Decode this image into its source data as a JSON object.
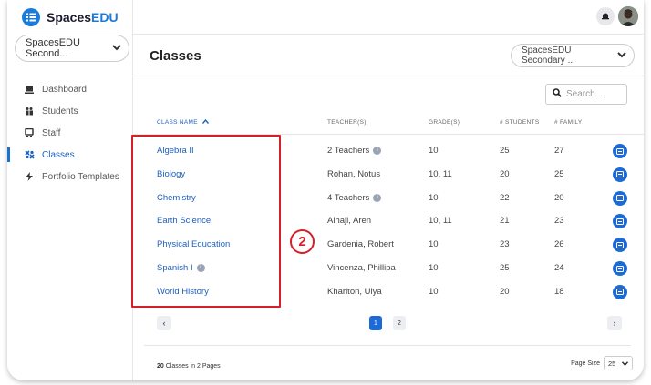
{
  "app": {
    "logo_text_prefix": "Spaces",
    "logo_text_suffix": "EDU",
    "school_select": "SpacesEDU Second...",
    "brand_color": "#1c7bd8"
  },
  "sidebar": {
    "items": [
      {
        "label": "Dashboard",
        "icon": "monitor-icon",
        "active": false
      },
      {
        "label": "Students",
        "icon": "students-icon",
        "active": false
      },
      {
        "label": "Staff",
        "icon": "staff-icon",
        "active": false
      },
      {
        "label": "Classes",
        "icon": "classes-icon",
        "active": true
      },
      {
        "label": "Portfolio Templates",
        "icon": "lightning-icon",
        "active": false
      }
    ]
  },
  "header": {
    "page_title": "Classes",
    "scope_select": "SpacesEDU Secondary ...",
    "search_placeholder": "Search..."
  },
  "table": {
    "columns": [
      "CLASS NAME",
      "TEACHER(S)",
      "GRADE(S)",
      "# STUDENTS",
      "# FAMILY"
    ],
    "sort_indicator": "^",
    "rows": [
      {
        "name": "Algebra II",
        "name_info": false,
        "teacher": "2 Teachers",
        "teacher_info": true,
        "grades": "10",
        "students": "25",
        "family": "27"
      },
      {
        "name": "Biology",
        "name_info": false,
        "teacher": "Rohan, Notus",
        "teacher_info": false,
        "grades": "10, 11",
        "students": "20",
        "family": "25"
      },
      {
        "name": "Chemistry",
        "name_info": false,
        "teacher": "4 Teachers",
        "teacher_info": true,
        "grades": "10",
        "students": "22",
        "family": "20"
      },
      {
        "name": "Earth Science",
        "name_info": false,
        "teacher": "Alhaji, Aren",
        "teacher_info": false,
        "grades": "10, 11",
        "students": "21",
        "family": "23"
      },
      {
        "name": "Physical Education",
        "name_info": false,
        "teacher": "Gardenia, Robert",
        "teacher_info": false,
        "grades": "10",
        "students": "23",
        "family": "26"
      },
      {
        "name": "Spanish I",
        "name_info": true,
        "teacher": "Vincenza, Phillipa",
        "teacher_info": false,
        "grades": "10",
        "students": "25",
        "family": "24"
      },
      {
        "name": "World History",
        "name_info": false,
        "teacher": "Khariton, Ulya",
        "teacher_info": false,
        "grades": "10",
        "students": "20",
        "family": "18"
      }
    ]
  },
  "annotation": {
    "callout_number": "2",
    "highlight_color": "#d42028"
  },
  "pagination": {
    "prev": "‹",
    "next": "›",
    "pages": [
      "1",
      "2"
    ],
    "current_page": "1"
  },
  "footer": {
    "summary_count": "20",
    "summary_text": " Classes in 2 Pages",
    "page_size_label": "Page Size",
    "page_size_value": "25"
  }
}
